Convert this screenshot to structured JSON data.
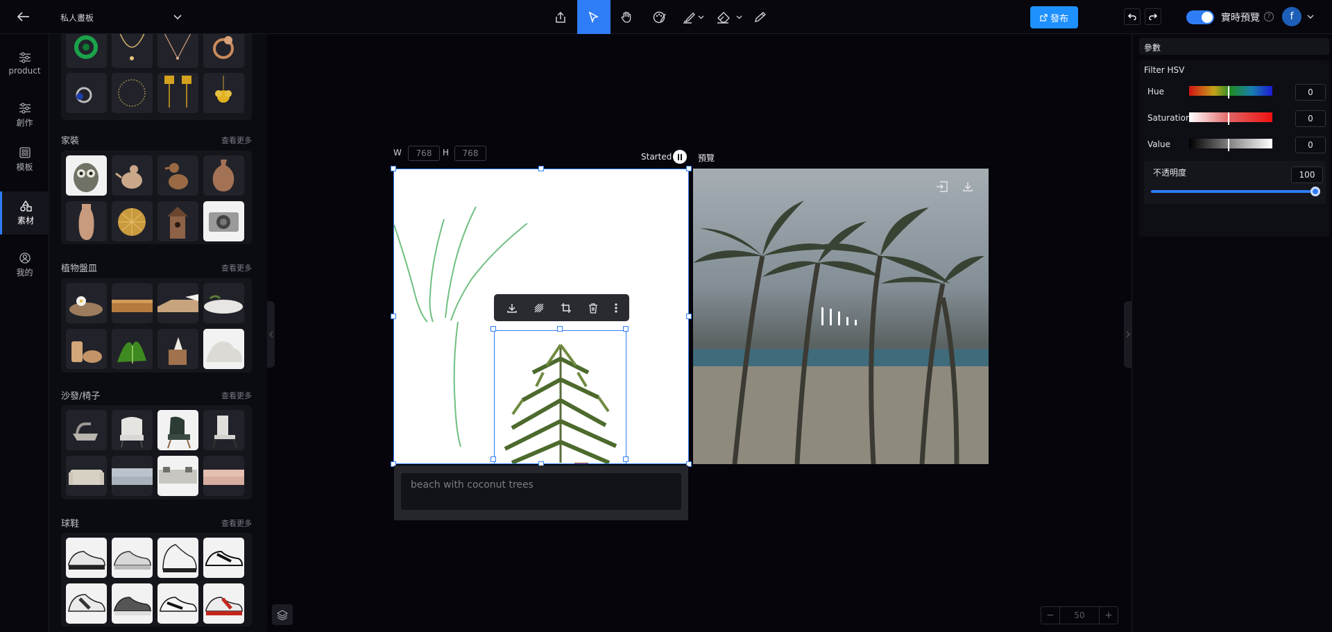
{
  "header": {
    "board_name": "私人畫板",
    "publish_label": "發布",
    "realtime_label": "實時預覽",
    "avatar_letter": "f"
  },
  "leftnav": {
    "items": [
      {
        "label": "product"
      },
      {
        "label": "創作"
      },
      {
        "label": "模板"
      },
      {
        "label": "素材"
      },
      {
        "label": "我的"
      }
    ]
  },
  "materials": {
    "more_label": "查看更多",
    "sections": [
      {
        "title": "家裝"
      },
      {
        "title": "植物盤皿"
      },
      {
        "title": "沙發/椅子"
      },
      {
        "title": "球鞋"
      }
    ]
  },
  "canvas": {
    "w_label": "W",
    "w_value": "768",
    "h_label": "H",
    "h_value": "768",
    "status": "Started",
    "preview_label": "預覽",
    "prompt": "beach with coconut trees",
    "zoom": "50"
  },
  "params": {
    "title": "參數",
    "filter_title": "Filter HSV",
    "hue": {
      "label": "Hue",
      "value": "0"
    },
    "saturation": {
      "label": "Saturation",
      "value": "0"
    },
    "value": {
      "label": "Value",
      "value": "0"
    },
    "opacity": {
      "label": "不透明度",
      "value": "100"
    }
  },
  "colors": {
    "accent": "#2f7df6",
    "publish_bg": "#1e90ff",
    "background": "#05050b"
  }
}
